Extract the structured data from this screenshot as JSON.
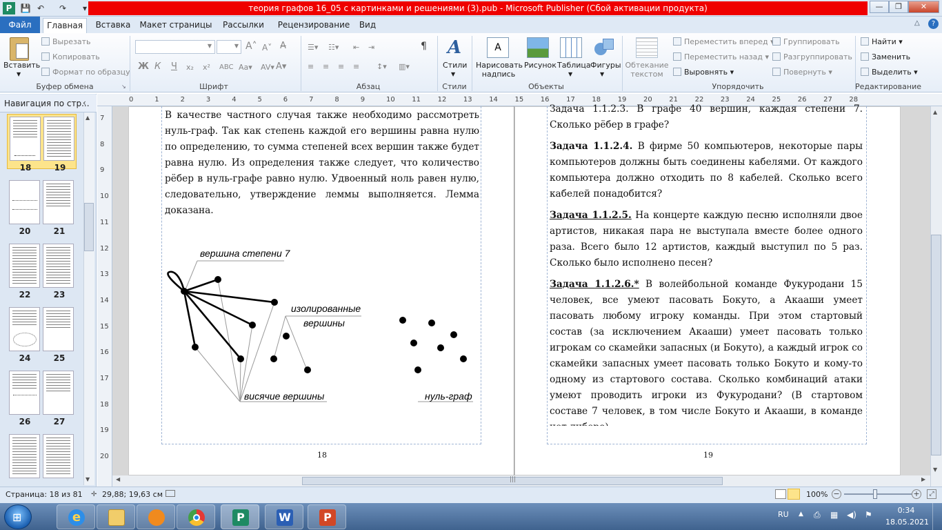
{
  "window": {
    "title": "теория графов 16_05 с картинками и решениями (3).pub  -  Microsoft Publisher (Сбой активации продукта)"
  },
  "tabs": [
    "Файл",
    "Главная",
    "Вставка",
    "Макет страницы",
    "Рассылки",
    "Рецензирование",
    "Вид"
  ],
  "ribbon": {
    "clipboard": {
      "paste": "Вставить",
      "cut": "Вырезать",
      "copy": "Копировать",
      "format": "Формат по образцу",
      "label": "Буфер обмена"
    },
    "font": {
      "label": "Шрифт"
    },
    "paragraph": {
      "label": "Абзац"
    },
    "styles": {
      "btn": "Стили",
      "label": "Стили"
    },
    "objects": {
      "draw": "Нарисовать надпись",
      "picture": "Рисунок",
      "table": "Таблица",
      "shapes": "Фигуры",
      "label": "Объекты"
    },
    "arrange": {
      "wrap": "Обтекание текстом",
      "forward": "Переместить вперед",
      "backward": "Переместить назад",
      "align": "Выровнять",
      "group": "Группировать",
      "ungroup": "Разгруппировать",
      "rotate": "Повернуть",
      "label": "Упорядочить"
    },
    "editing": {
      "find": "Найти",
      "replace": "Заменить",
      "select": "Выделить",
      "label": "Редактирование"
    }
  },
  "nav": {
    "title": "Навигация по стр...",
    "thumbs": [
      [
        "18",
        "19"
      ],
      [
        "20",
        "21"
      ],
      [
        "22",
        "23"
      ],
      [
        "24",
        "25"
      ],
      [
        "26",
        "27"
      ]
    ]
  },
  "rulers": {
    "h": [
      "0",
      "1",
      "2",
      "3",
      "4",
      "5",
      "6",
      "7",
      "8",
      "9",
      "10",
      "11",
      "12",
      "13",
      "14",
      "15",
      "16",
      "17",
      "18",
      "19",
      "20",
      "21",
      "22",
      "23",
      "24",
      "25",
      "26",
      "27",
      "28"
    ],
    "v": [
      "7",
      "8",
      "9",
      "10",
      "11",
      "12",
      "13",
      "14",
      "15",
      "16",
      "17",
      "18",
      "19",
      "20"
    ]
  },
  "page18": {
    "text": "В качестве частного случая также необходимо рассмотреть нуль-граф. Так как степень каждой его вершины равна нулю по определению, то сумма степеней всех вершин также будет равна нулю. Из определения также следует, что количество рёбер в нуль-графе равно нулю. Удвоенный ноль равен нулю, следовательно, утверждение леммы выполняется. Лемма доказана.",
    "fig_vertex7": "вершина степени 7",
    "fig_isolated1": "изолированные",
    "fig_isolated2": "вершины",
    "fig_hanging": "висячие вершины",
    "fig_null": "нуль-граф",
    "number": "18"
  },
  "page19": {
    "t3_tail": "Задача 1.1.2.3. В графе 40 вершин, каждая степени 7. Сколько рёбер в графе?",
    "t4_title": "Задача 1.1.2.4.",
    "t4_text": " В фирме 50 компьютеров, некоторые пары компьютеров должны быть соединены кабелями. От каждого компьютера должно отходить по 8 кабелей. Сколько всего кабелей понадобится?",
    "t5_title": "Задача 1.1.2.5.",
    "t5_text": " На концерте каждую песню исполняли двое артистов, никакая пара не выступала вместе более одного раза. Всего было 12 артистов, каждый выступил по 5 раз. Сколько было исполнено песен?",
    "t6_title": "Задача 1.1.2.6.*",
    "t6_text": " В волейбольной команде Фукуродани 15 человек, все умеют пасовать Бокуто, а Акааши умеет пасовать любому игроку команды. При этом стартовый состав (за исключением Акааши) умеет пасовать только игрокам со скамейки запасных (и Бокуто), а каждый игрок со скамейки запасных умеет пасовать только Бокуто и кому-то одному из стартового состава. Сколько комбинаций атаки умеют проводить игроки из Фукуродани? (В стартовом составе 7 человек, в том числе Бокуто и Акааши, в команде нет либеро).",
    "number": "19"
  },
  "status": {
    "page": "Страница: 18 из 81",
    "coords": "29,88; 19,63 см",
    "zoom": "100%"
  },
  "taskbar": {
    "lang": "RU",
    "time": "0:34",
    "date": "18.05.2021"
  }
}
